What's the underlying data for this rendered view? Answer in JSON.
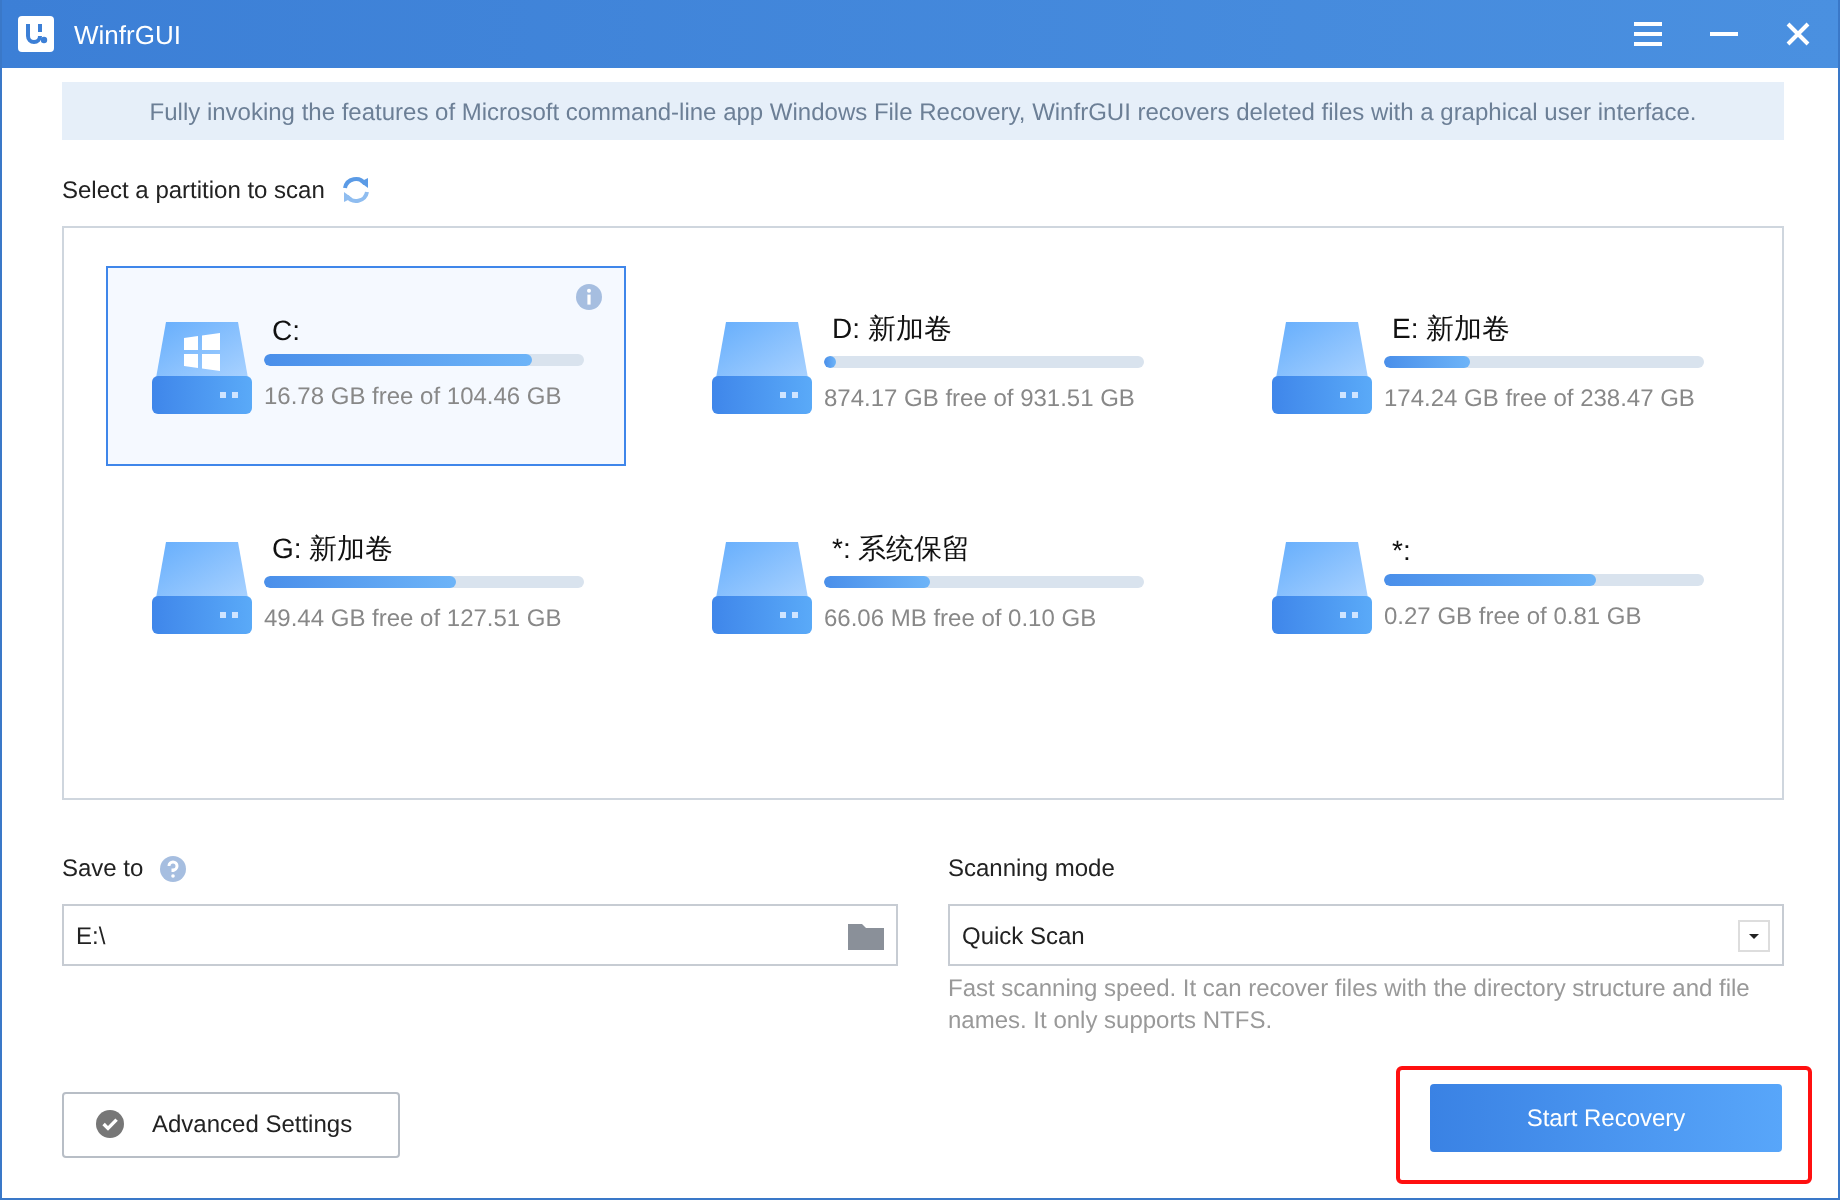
{
  "window": {
    "title": "WinfrGUI"
  },
  "banner": "Fully invoking the features of Microsoft command-line app Windows File Recovery, WinfrGUI recovers deleted files with a graphical user interface.",
  "partitions_label": "Select a partition to scan",
  "partitions": [
    {
      "name": "C:",
      "kind": "system",
      "level": 0.84,
      "space": "16.78 GB free of 104.46 GB",
      "selected": true
    },
    {
      "name": "D: 新加卷",
      "kind": "data",
      "level": 0.04,
      "space": "874.17 GB free of 931.51 GB",
      "selected": false
    },
    {
      "name": "E: 新加卷",
      "kind": "data",
      "level": 0.27,
      "space": "174.24 GB free of 238.47 GB",
      "selected": false
    },
    {
      "name": "G: 新加卷",
      "kind": "data",
      "level": 0.6,
      "space": "49.44 GB free of 127.51 GB",
      "selected": false
    },
    {
      "name": "*: 系统保留",
      "kind": "data",
      "level": 0.33,
      "space": "66.06 MB free of 0.10 GB",
      "selected": false
    },
    {
      "name": "*:",
      "kind": "data",
      "level": 0.66,
      "space": "0.27 GB free of 0.81 GB",
      "selected": false
    }
  ],
  "save_to": {
    "label": "Save to",
    "value": "E:\\"
  },
  "scanning_mode": {
    "label": "Scanning mode",
    "value": "Quick Scan",
    "description": "Fast scanning speed. It can recover files with the directory structure and file names. It only supports NTFS."
  },
  "advanced_button": "Advanced Settings",
  "start_button": {
    "label": "Start Recovery",
    "highlighted": true
  }
}
